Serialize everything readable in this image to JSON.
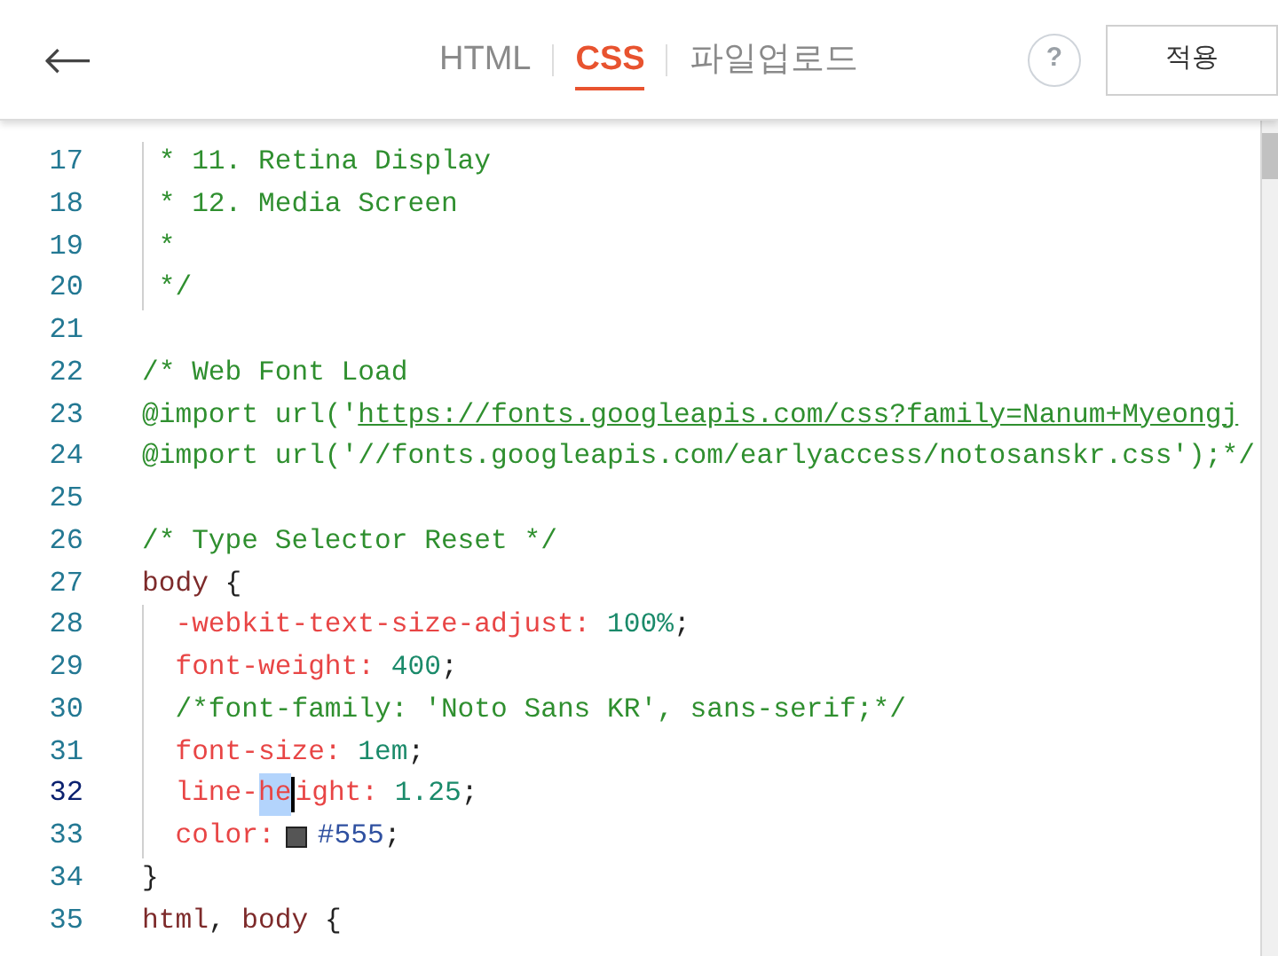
{
  "header": {
    "back": "←",
    "tabs": [
      {
        "label": "HTML",
        "selected": false
      },
      {
        "label": "CSS",
        "selected": true
      },
      {
        "label": "파일업로드",
        "selected": false
      }
    ],
    "help": "?",
    "apply_button": "적용"
  },
  "editor": {
    "lines": [
      {
        "number": "17",
        "active": false,
        "tokens": [
          {
            "kind": "comment",
            "text": " * 11. Retina Display"
          }
        ]
      },
      {
        "number": "18",
        "active": false,
        "tokens": [
          {
            "kind": "comment",
            "text": " * 12. Media Screen"
          }
        ]
      },
      {
        "number": "19",
        "active": false,
        "tokens": [
          {
            "kind": "comment",
            "text": " *"
          }
        ]
      },
      {
        "number": "20",
        "active": false,
        "tokens": [
          {
            "kind": "comment",
            "text": " */"
          }
        ]
      },
      {
        "number": "21",
        "active": false
      },
      {
        "number": "22",
        "active": false,
        "tokens": [
          {
            "kind": "comment",
            "text": "/* Web Font Load"
          }
        ]
      },
      {
        "number": "23",
        "active": false,
        "tokens": [
          {
            "kind": "comment",
            "text": "@import url('"
          },
          {
            "kind": "link",
            "text": "https://fonts.googleapis.com/css?family=Nanum+Myeongj"
          }
        ]
      },
      {
        "number": "24",
        "active": false,
        "tokens": [
          {
            "kind": "comment",
            "text": "@import url('//fonts.googleapis.com/earlyaccess/notosanskr.css');*/"
          }
        ]
      },
      {
        "number": "25",
        "active": false
      },
      {
        "number": "26",
        "active": false,
        "tokens": [
          {
            "kind": "comment",
            "text": "/* Type Selector Reset */"
          }
        ]
      },
      {
        "number": "27",
        "active": false,
        "tokens": [
          {
            "kind": "selector",
            "text": "body"
          },
          {
            "kind": "punct",
            "text": " {"
          }
        ]
      },
      {
        "number": "28",
        "active": false,
        "tokens": [
          {
            "kind": "property",
            "text": "  -webkit-text-size-adjust:"
          },
          {
            "kind": "value",
            "text": " 100%"
          },
          {
            "kind": "punct",
            "text": ";"
          }
        ]
      },
      {
        "number": "29",
        "active": false,
        "tokens": [
          {
            "kind": "property",
            "text": "  font-weight:"
          },
          {
            "kind": "value",
            "text": " 400"
          },
          {
            "kind": "punct",
            "text": ";"
          }
        ]
      },
      {
        "number": "30",
        "active": false,
        "tokens": [
          {
            "kind": "comment",
            "text": "  /*font-family: 'Noto Sans KR', sans-serif;*/"
          }
        ]
      },
      {
        "number": "31",
        "active": false,
        "tokens": [
          {
            "kind": "property",
            "text": "  font-size:"
          },
          {
            "kind": "value",
            "text": " 1em"
          },
          {
            "kind": "punct",
            "text": ";"
          }
        ]
      },
      {
        "number": "32",
        "active": true,
        "tokens": [
          {
            "kind": "property",
            "text": "  line-"
          },
          {
            "kind": "selection",
            "text": "he"
          },
          {
            "kind": "property",
            "text": "ight:"
          },
          {
            "kind": "value",
            "text": " 1.25"
          },
          {
            "kind": "punct",
            "text": ";"
          }
        ]
      },
      {
        "number": "33",
        "active": false,
        "tokens": [
          {
            "kind": "property",
            "text": "  color:"
          },
          {
            "kind": "swatch",
            "color": "#555555"
          },
          {
            "kind": "color",
            "text": "#555"
          },
          {
            "kind": "punct",
            "text": ";"
          }
        ]
      },
      {
        "number": "34",
        "active": false,
        "tokens": [
          {
            "kind": "punct",
            "text": "}"
          }
        ]
      },
      {
        "number": "35",
        "active": false,
        "tokens": [
          {
            "kind": "selector",
            "text": "html"
          },
          {
            "kind": "punct",
            "text": ", "
          },
          {
            "kind": "selector",
            "text": "body"
          },
          {
            "kind": "punct",
            "text": " {"
          }
        ]
      }
    ]
  }
}
